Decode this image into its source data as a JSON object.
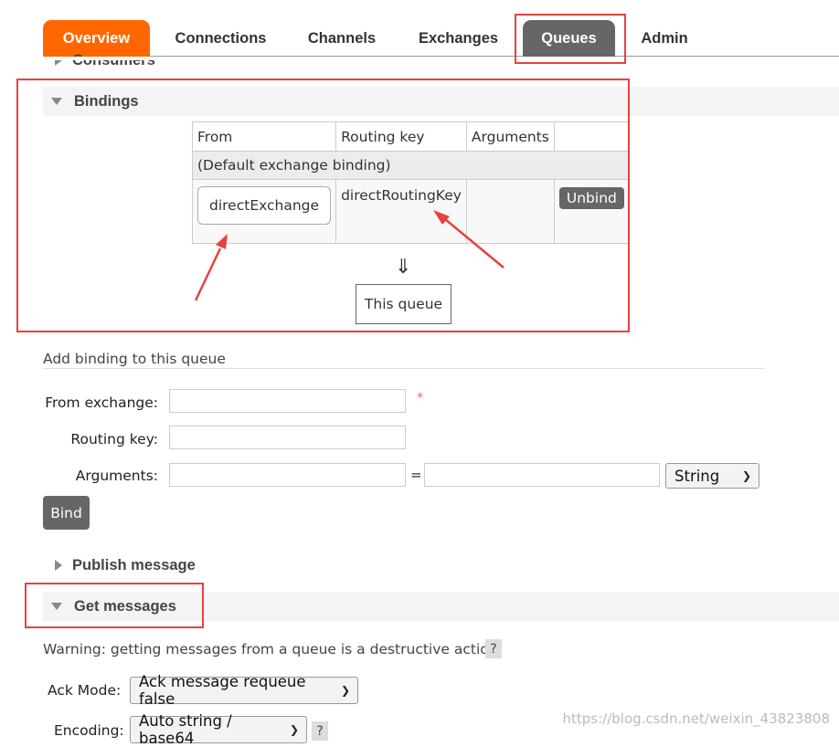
{
  "nav": {
    "tabs": [
      {
        "label": "Overview"
      },
      {
        "label": "Connections"
      },
      {
        "label": "Channels"
      },
      {
        "label": "Exchanges"
      },
      {
        "label": "Queues"
      },
      {
        "label": "Admin"
      }
    ],
    "active_tab": "Queues",
    "brand_color": "#ff6600",
    "active_color": "#666666"
  },
  "sections": {
    "consumers": "Consumers",
    "bindings": "Bindings",
    "publish": "Publish message",
    "get": "Get messages"
  },
  "bindings": {
    "headers": [
      "From",
      "Routing key",
      "Arguments",
      ""
    ],
    "default_row": "(Default exchange binding)",
    "row": {
      "from": "directExchange",
      "routing_key": "directRoutingKey",
      "arguments": "",
      "action": "Unbind"
    },
    "arrow": "⇓",
    "this_queue": "This queue"
  },
  "add_binding": {
    "title": "Add binding to this queue",
    "from_label": "From exchange:",
    "routing_label": "Routing key:",
    "args_label": "Arguments:",
    "required": "*",
    "eq": "=",
    "type_select": "String",
    "button": "Bind"
  },
  "get_messages": {
    "warning": "Warning: getting messages from a queue is a destructive action.",
    "help": "?",
    "ack_label": "Ack Mode:",
    "ack_value": "Ack message requeue false",
    "encoding_label": "Encoding:",
    "encoding_value": "Auto string / base64"
  },
  "watermark": "https://blog.csdn.net/weixin_43823808",
  "annotation_color": "#e8413f"
}
